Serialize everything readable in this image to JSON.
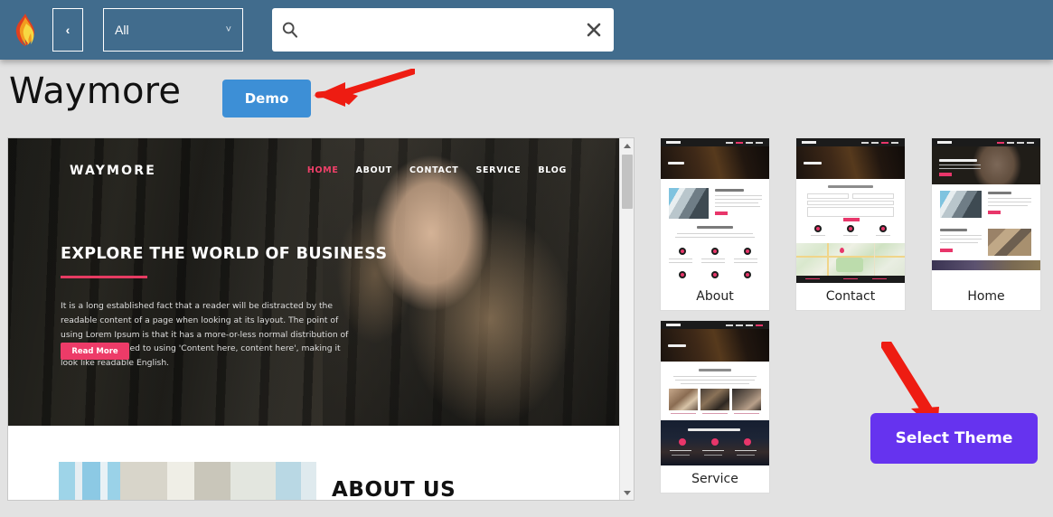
{
  "toolbar": {
    "logo_icon": "flame-logo-icon",
    "back_label": "‹",
    "scope_value": "All",
    "scope_caret": "˅",
    "search_value": "",
    "search_placeholder": "",
    "search_icon": "search-icon",
    "clear_icon": "clear-x-icon"
  },
  "theme": {
    "name": "Waymore",
    "demo_label": "Demo",
    "select_label": "Select Theme"
  },
  "preview": {
    "brand": "WAYMORE",
    "nav": [
      {
        "label": "HOME",
        "active": true
      },
      {
        "label": "ABOUT",
        "active": false
      },
      {
        "label": "CONTACT",
        "active": false
      },
      {
        "label": "SERVICE",
        "active": false
      },
      {
        "label": "BLOG",
        "active": false
      }
    ],
    "headline": "EXPLORE THE WORLD OF BUSINESS",
    "body": "It is a long established fact that a reader will be distracted by the readable content of a page when looking at its layout. The point of using Lorem Ipsum is that it has a more-or-less normal distribution of letters, as opposed to using 'Content here, content here', making it look like readable English.",
    "cta_label": "Read More",
    "section_title": "ABOUT US"
  },
  "cards": [
    {
      "label": "About",
      "kind": "about"
    },
    {
      "label": "Contact",
      "kind": "contact"
    },
    {
      "label": "Home",
      "kind": "home"
    },
    {
      "label": "Service",
      "kind": "service"
    }
  ],
  "card_content": {
    "about": {
      "heading": "ABOUT WAYMORE",
      "subheading": "WHY CHOOSE US"
    },
    "contact": {
      "heading": "SEND US A MESSAGE"
    },
    "home": {
      "heading": "ABOUT US",
      "subheading": "OUR MISSION"
    },
    "service": {
      "heading": "OUR SERVICES",
      "subheading": "WHAT MAKES US SPECIAL"
    }
  },
  "colors": {
    "toolbar": "#416c8d",
    "page_bg": "#e2e2e2",
    "demo_button": "#3d8fd6",
    "select_button": "#6633ef",
    "accent_pink": "#ed3b68",
    "arrow_red": "#ee1c12"
  },
  "scrollbar": {
    "up_icon": "triangle-up-icon",
    "down_icon": "triangle-down-icon"
  }
}
